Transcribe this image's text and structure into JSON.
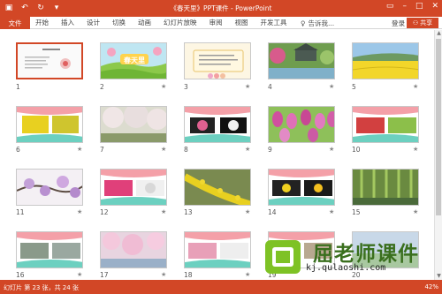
{
  "titlebar": {
    "title": "《春天里》PPT课件 - PowerPoint"
  },
  "ribbon": {
    "file_label": "文件",
    "tabs": [
      "开始",
      "插入",
      "设计",
      "切换",
      "动画",
      "幻灯片放映",
      "审阅",
      "视图",
      "开发工具"
    ],
    "tell_me": "告诉我...",
    "login": "登录",
    "share": "共享"
  },
  "slides": [
    {
      "n": "1",
      "star": ""
    },
    {
      "n": "2",
      "star": "★"
    },
    {
      "n": "3",
      "star": "★"
    },
    {
      "n": "4",
      "star": "★"
    },
    {
      "n": "5",
      "star": "★"
    },
    {
      "n": "6",
      "star": "★"
    },
    {
      "n": "7",
      "star": "★"
    },
    {
      "n": "8",
      "star": "★"
    },
    {
      "n": "9",
      "star": "★"
    },
    {
      "n": "10",
      "star": "★"
    },
    {
      "n": "11",
      "star": "★"
    },
    {
      "n": "12",
      "star": "★"
    },
    {
      "n": "13",
      "star": "★"
    },
    {
      "n": "14",
      "star": "★"
    },
    {
      "n": "15",
      "star": "★"
    },
    {
      "n": "16",
      "star": "★"
    },
    {
      "n": "17",
      "star": "★"
    },
    {
      "n": "18",
      "star": "★"
    },
    {
      "n": "19",
      "star": "★"
    },
    {
      "n": "20",
      "star": "★"
    }
  ],
  "slide2_title": "春天里",
  "status": {
    "info": "幻灯片 第 23 张，共 24 张",
    "zoom": "42%"
  },
  "watermark": {
    "text": "屈老师课件",
    "url": "kj.qulaoshi.com"
  },
  "colors": {
    "accent": "#d24726"
  }
}
